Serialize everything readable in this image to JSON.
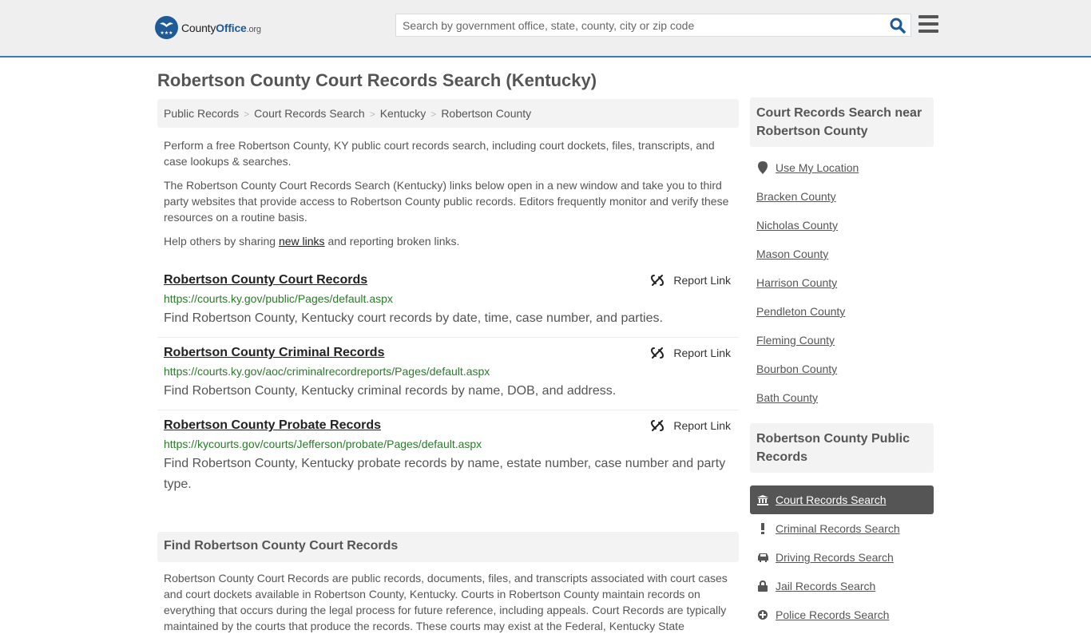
{
  "header": {
    "logo": {
      "brand_left": "County",
      "brand_right": "Office",
      "tld": ".org"
    },
    "search": {
      "placeholder": "Search by government office, state, county, city or zip code",
      "value": ""
    },
    "icons": {
      "search": "search-icon",
      "menu": "hamburger-menu-icon"
    }
  },
  "page": {
    "title": "Robertson County Court Records Search (Kentucky)"
  },
  "breadcrumb": [
    {
      "label": "Public Records"
    },
    {
      "label": "Court Records Search"
    },
    {
      "label": "Kentucky"
    },
    {
      "label": "Robertson County"
    }
  ],
  "intro": {
    "p1": "Perform a free Robertson County, KY public court records search, including court dockets, files, transcripts, and case lookups & searches.",
    "p2": "The Robertson County Court Records Search (Kentucky) links below open in a new window and take you to third party websites that provide access to Robertson County public records. Editors frequently monitor and verify these resources on a routine basis.",
    "p3_before": "Help others by sharing ",
    "p3_link": "new links",
    "p3_after": " and reporting broken links."
  },
  "records": [
    {
      "title": "Robertson County Court Records",
      "url": "https://courts.ky.gov/public/Pages/default.aspx",
      "description": "Find Robertson County, Kentucky court records by date, time, case number, and parties.",
      "report_label": "Report Link"
    },
    {
      "title": "Robertson County Criminal Records",
      "url": "https://courts.ky.gov/aoc/criminalrecordreports/Pages/default.aspx",
      "description": "Find Robertson County, Kentucky criminal records by name, DOB, and address.",
      "report_label": "Report Link"
    },
    {
      "title": "Robertson County Probate Records",
      "url": "https://kycourts.gov/courts/Jefferson/probate/Pages/default.aspx",
      "description": "Find Robertson County, Kentucky probate records by name, estate number, case number and party type.",
      "report_label": "Report Link"
    }
  ],
  "find_section": {
    "heading": "Find Robertson County Court Records",
    "body": "Robertson County Court Records are public records, documents, files, and transcripts associated with court cases and court dockets available in Robertson County, Kentucky. Courts in Robertson County maintain records on everything that occurs during the legal process for future reference, including appeals. Court Records are typically maintained by the courts that produce the records. These courts may exist at the Federal, Kentucky State"
  },
  "sidebar": {
    "near_heading": "Court Records Search near Robertson County",
    "use_location": "Use My Location",
    "nearby": [
      "Bracken County",
      "Nicholas County",
      "Mason County",
      "Harrison County",
      "Pendleton County",
      "Fleming County",
      "Bourbon County",
      "Bath County"
    ],
    "public_heading": "Robertson County Public Records",
    "public_links": [
      {
        "label": "Court Records Search",
        "icon": "courthouse-icon",
        "active": true
      },
      {
        "label": "Criminal Records Search",
        "icon": "exclamation-icon",
        "active": false
      },
      {
        "label": "Driving Records Search",
        "icon": "car-icon",
        "active": false
      },
      {
        "label": "Jail Records Search",
        "icon": "lock-icon",
        "active": false
      },
      {
        "label": "Police Records Search",
        "icon": "police-badge-icon",
        "active": false
      }
    ]
  },
  "colors": {
    "accent": "#3a7db5",
    "brand": "#1d5a96",
    "url_green": "#2a7a2a",
    "active_bg": "#555555"
  }
}
